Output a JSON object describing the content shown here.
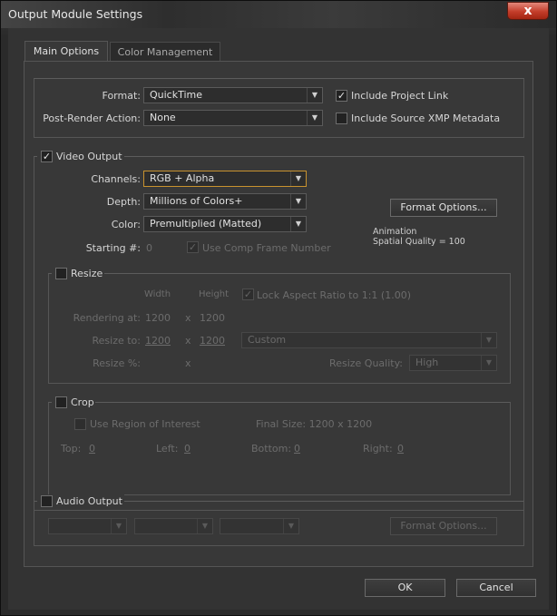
{
  "window": {
    "title": "Output Module Settings",
    "close_glyph": "x"
  },
  "tabs": [
    {
      "label": "Main Options"
    },
    {
      "label": "Color Management"
    }
  ],
  "format_section": {
    "format_label": "Format:",
    "format_value": "QuickTime",
    "post_render_label": "Post-Render Action:",
    "post_render_value": "None",
    "include_project_link_label": "Include Project Link",
    "include_project_link_checked": "✓",
    "include_xmp_label": "Include Source XMP Metadata"
  },
  "video_output": {
    "label": "Video Output",
    "checked": "✓",
    "channels_label": "Channels:",
    "channels_value": "RGB + Alpha",
    "depth_label": "Depth:",
    "depth_value": "Millions of Colors+",
    "color_label": "Color:",
    "color_value": "Premultiplied (Matted)",
    "starting_label": "Starting #:",
    "starting_value": "0",
    "use_comp_frame_label": "Use Comp Frame Number",
    "use_comp_frame_checked": "✓",
    "format_options_button": "Format Options...",
    "codec_info_line1": "Animation",
    "codec_info_line2": "Spatial Quality = 100"
  },
  "resize": {
    "label": "Resize",
    "width_header": "Width",
    "height_header": "Height",
    "lock_aspect_label": "Lock Aspect Ratio to 1:1 (1.00)",
    "lock_aspect_checked": "✓",
    "rendering_at_label": "Rendering at:",
    "rendering_w": "1200",
    "rendering_x": "x",
    "rendering_h": "1200",
    "resize_to_label": "Resize to:",
    "resize_w": "1200",
    "resize_x": "x",
    "resize_h": "1200",
    "preset_value": "Custom",
    "resize_pct_label": "Resize %:",
    "resize_pct_x": "x",
    "quality_label": "Resize Quality:",
    "quality_value": "High"
  },
  "crop": {
    "label": "Crop",
    "use_roi_label": "Use Region of Interest",
    "final_size_label": "Final Size: 1200 x 1200",
    "top_label": "Top:",
    "top_value": "0",
    "left_label": "Left:",
    "left_value": "0",
    "bottom_label": "Bottom:",
    "bottom_value": "0",
    "right_label": "Right:",
    "right_value": "0"
  },
  "audio_output": {
    "label": "Audio Output",
    "format_options_button": "Format Options..."
  },
  "footer": {
    "ok_label": "OK",
    "cancel_label": "Cancel"
  },
  "icons": {
    "dropdown": "▼"
  },
  "colors": {
    "accent_focus": "#c8922e",
    "close_red": "#c33d2a"
  }
}
